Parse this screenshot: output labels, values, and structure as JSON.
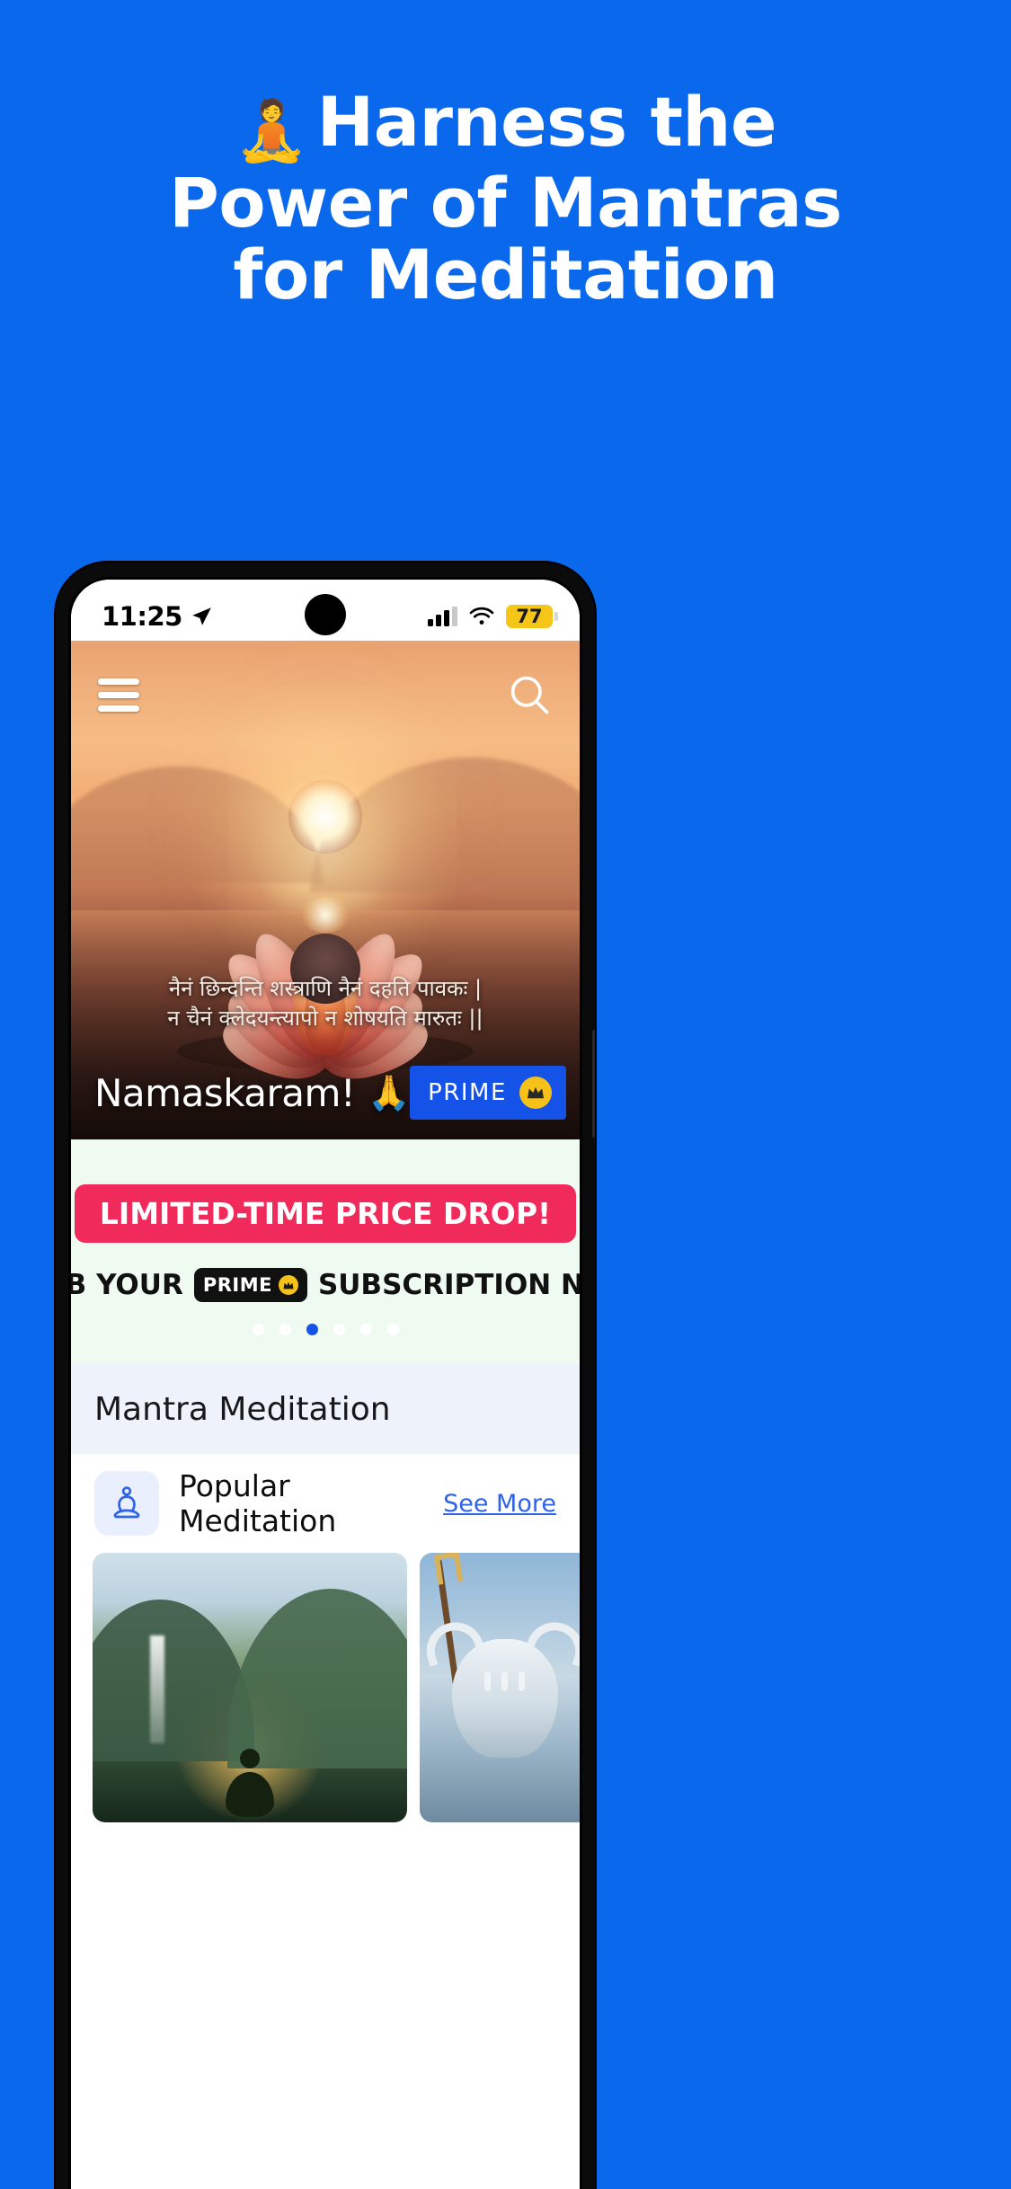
{
  "poster": {
    "background_color": "#0a68ec",
    "headline_lines": [
      "Harness the",
      "Power of Mantras",
      "for Meditation"
    ],
    "headline_emoji": "🧘",
    "headline_color": "#ffffff"
  },
  "phone": {
    "status_bar": {
      "time": "11:25",
      "location_icon": "location-arrow-icon",
      "signal_icon": "cellular-signal-icon",
      "wifi_icon": "wifi-icon",
      "battery_level": "77",
      "battery_color": "#f5c518"
    },
    "hero": {
      "menu_icon": "hamburger-menu-icon",
      "search_icon": "search-icon",
      "shloka_line_1": "नैनं छिन्दन्ति शस्त्राणि नैनं दहति पावकः |",
      "shloka_line_2": "न चैनं क्लेदयन्त्यापो न शोषयति मारुतः ||",
      "greeting": "Namaskaram!",
      "greeting_emoji": "🙏",
      "prime_button_label": "PRIME",
      "prime_button_icon": "crown-icon",
      "prime_button_color": "#1552e8"
    },
    "promo": {
      "pill_text": "LIMITED-TIME PRICE DROP!",
      "pill_color": "#f02a5b",
      "subtitle_before": "GRAB YOUR",
      "chip_text": "PRIME",
      "chip_icon": "crown-icon",
      "subtitle_after": "SUBSCRIPTION NOW!",
      "background_color": "#effaf1",
      "carousel_total_dots": 6,
      "carousel_active_index": 3,
      "active_dot_color": "#1552e8"
    },
    "sections": {
      "mantra_meditation_title": "Mantra Meditation",
      "popular_row": {
        "icon": "meditation-person-icon",
        "label": "Popular Meditation",
        "see_more_label": "See More",
        "see_more_color": "#2f63e8"
      },
      "cards": [
        {
          "name": "mountain-sunrise-card"
        },
        {
          "name": "nandi-bull-card"
        }
      ]
    }
  }
}
